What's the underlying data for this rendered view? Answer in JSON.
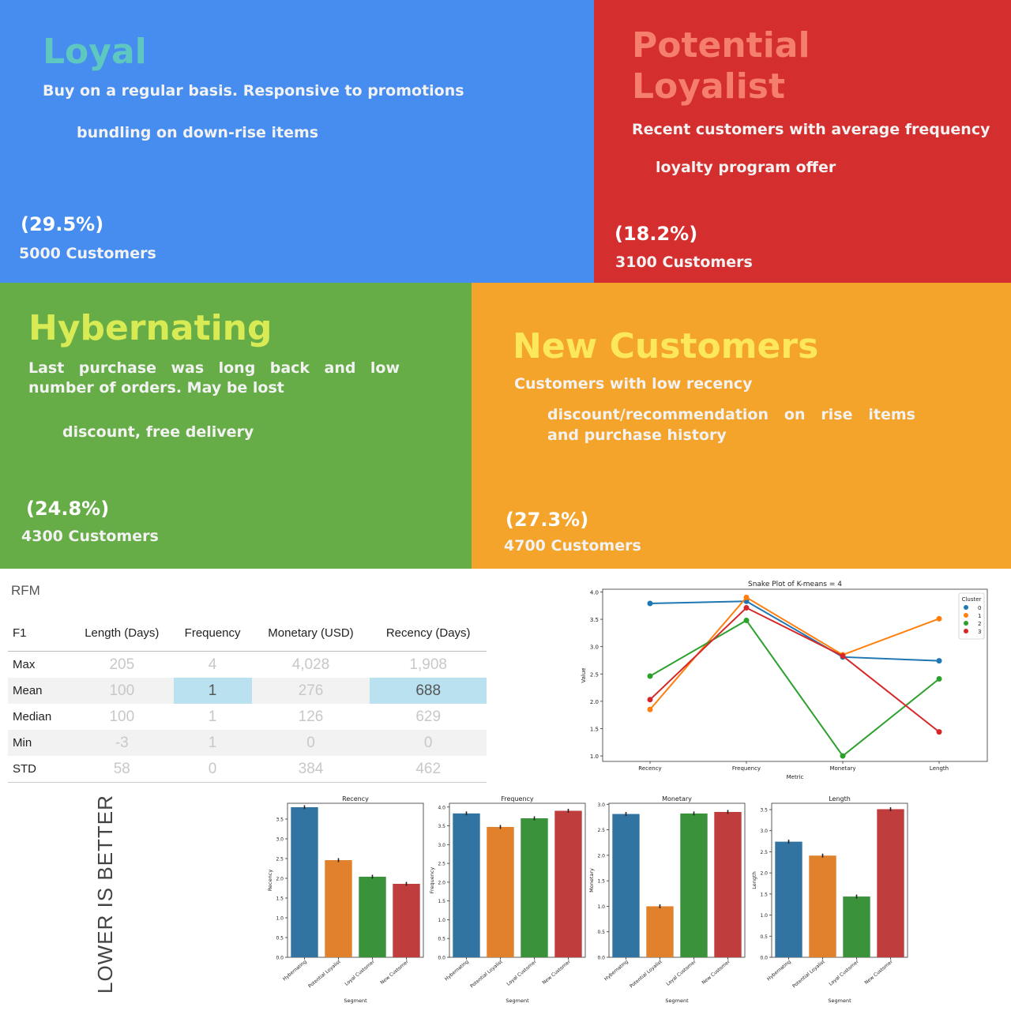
{
  "segments": {
    "loyal": {
      "title": "Loyal",
      "description": "Buy on a regular basis. Responsive to promotions",
      "action": "bundling on down-rise items",
      "percent": "(29.5%)",
      "count": "5000 Customers",
      "bg": "#468def",
      "title_color": "#5dc7c0"
    },
    "potential": {
      "title_line1": "Potential",
      "title_line2": "Loyalist",
      "description": "Recent customers with average frequency",
      "action": "loyalty program offer",
      "percent": "(18.2%)",
      "count": "3100 Customers",
      "bg": "#d52e2e",
      "title_color": "#f57f6c"
    },
    "hybernating": {
      "title": "Hybernating",
      "description": "Last purchase was long back and low number of orders. May be lost",
      "action": "discount, free delivery",
      "percent": "(24.8%)",
      "count": "4300 Customers",
      "bg": "#67ad47",
      "title_color": "#d8ea54"
    },
    "new": {
      "title": "New Customers",
      "description": "Customers with low recency",
      "action": "discount/recommendation on rise items and purchase history",
      "percent": "(27.3%)",
      "count": "4700 Customers",
      "bg": "#f4a42b",
      "title_color": "#fde75b"
    }
  },
  "rfm": {
    "label": "RFM",
    "headers": [
      "F1",
      "Length (Days)",
      "Frequency",
      "Monetary (USD)",
      "Recency (Days)"
    ],
    "rows": [
      {
        "label": "Max",
        "values": [
          "205",
          "4",
          "4,028",
          "1,908"
        ]
      },
      {
        "label": "Mean",
        "values": [
          "100",
          "1",
          "276",
          "688"
        ]
      },
      {
        "label": "Median",
        "values": [
          "100",
          "1",
          "126",
          "629"
        ]
      },
      {
        "label": "Min",
        "values": [
          "-3",
          "1",
          "0",
          "0"
        ]
      },
      {
        "label": "STD",
        "values": [
          "58",
          "0",
          "384",
          "462"
        ]
      }
    ],
    "highlight_color": "#b9e1f0"
  },
  "lower_note": "LOWER IS BETTER",
  "palette": {
    "c0": "#1f77b4",
    "c1": "#ff7f0e",
    "c2": "#2ca02c",
    "c3": "#d62728",
    "bar_blue": "#3274a1",
    "bar_orange": "#e1812c",
    "bar_green": "#3a923a",
    "bar_red": "#c03d3e"
  },
  "chart_data": [
    {
      "type": "line",
      "title": "Snake Plot of K-means = 4",
      "xlabel": "Metric",
      "ylabel": "Value",
      "categories": [
        "Recency",
        "Frequency",
        "Monetary",
        "Length"
      ],
      "ylim": [
        0.9,
        4.05
      ],
      "yticks": [
        "1.0",
        "1.5",
        "2.0",
        "2.5",
        "3.0",
        "3.5",
        "4.0"
      ],
      "legend_title": "Cluster",
      "legend_position": "top-right",
      "series": [
        {
          "name": "0",
          "values": [
            3.79,
            3.83,
            2.81,
            2.74
          ]
        },
        {
          "name": "1",
          "values": [
            1.85,
            3.9,
            2.85,
            3.51
          ]
        },
        {
          "name": "2",
          "values": [
            2.46,
            3.48,
            1.0,
            2.41
          ]
        },
        {
          "name": "3",
          "values": [
            2.03,
            3.71,
            2.83,
            1.44
          ]
        }
      ]
    },
    {
      "type": "bar",
      "title": "Recency",
      "xlabel": "Segment",
      "ylabel": "Recency",
      "categories": [
        "Hybernating",
        "Potential Loyalist",
        "Loyal Customer",
        "New Customer"
      ],
      "values": [
        3.8,
        2.46,
        2.04,
        1.86
      ],
      "ylim": [
        0,
        3.9
      ],
      "yticks": [
        "0.0",
        "0.5",
        "1.0",
        "1.5",
        "2.0",
        "2.5",
        "3.0",
        "3.5"
      ]
    },
    {
      "type": "bar",
      "title": "Frequency",
      "xlabel": "Segment",
      "ylabel": "Frequency",
      "categories": [
        "Hybernating",
        "Potential Loyalist",
        "Loyal Customer",
        "New Customer"
      ],
      "values": [
        3.83,
        3.47,
        3.7,
        3.9
      ],
      "ylim": [
        0,
        4.1
      ],
      "yticks": [
        "0.0",
        "0.5",
        "1.0",
        "1.5",
        "2.0",
        "2.5",
        "3.0",
        "3.5",
        "4.0"
      ]
    },
    {
      "type": "bar",
      "title": "Monetary",
      "xlabel": "Segment",
      "ylabel": "Monetary",
      "categories": [
        "Hybernating",
        "Potential Loyalist",
        "Loyal Customer",
        "New Customer"
      ],
      "values": [
        2.81,
        1.0,
        2.82,
        2.85
      ],
      "ylim": [
        0,
        3.02
      ],
      "yticks": [
        "0.0",
        "0.5",
        "1.0",
        "1.5",
        "2.0",
        "2.5",
        "3.0"
      ]
    },
    {
      "type": "bar",
      "title": "Length",
      "xlabel": "Segment",
      "ylabel": "Length",
      "categories": [
        "Hybernating",
        "Potential Loyalist",
        "Loyal Customer",
        "New Customer"
      ],
      "values": [
        2.74,
        2.41,
        1.44,
        3.51
      ],
      "ylim": [
        0,
        3.65
      ],
      "yticks": [
        "0.0",
        "0.5",
        "1.0",
        "1.5",
        "2.0",
        "2.5",
        "3.0",
        "3.5"
      ]
    }
  ]
}
